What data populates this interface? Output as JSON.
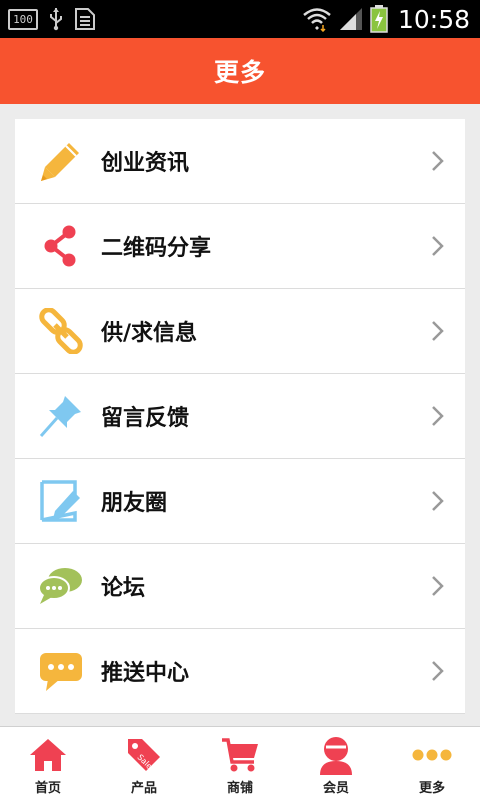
{
  "status_bar": {
    "time": "10:58",
    "battery_text": "100",
    "icons": [
      "battery-100-icon",
      "usb-icon",
      "sim-card-icon",
      "wifi-icon",
      "signal-icon",
      "charging-battery-icon"
    ]
  },
  "header": {
    "title": "更多"
  },
  "menu": {
    "items": [
      {
        "label": "创业资讯",
        "icon": "pencil-icon",
        "color": "#f5b63d"
      },
      {
        "label": "二维码分享",
        "icon": "share-icon",
        "color": "#ef4152"
      },
      {
        "label": "供/求信息",
        "icon": "chain-link-icon",
        "color": "#f5b63d"
      },
      {
        "label": "留言反馈",
        "icon": "pushpin-icon",
        "color": "#7fc8f0"
      },
      {
        "label": "朋友圈",
        "icon": "edit-note-icon",
        "color": "#7fc8f0"
      },
      {
        "label": "论坛",
        "icon": "chat-bubbles-icon",
        "color": "#a3c15a"
      },
      {
        "label": "推送中心",
        "icon": "message-bubble-icon",
        "color": "#f5b63d"
      }
    ]
  },
  "bottom_nav": {
    "items": [
      {
        "label": "首页",
        "icon": "home-icon",
        "active": false
      },
      {
        "label": "产品",
        "icon": "sale-tag-icon",
        "active": false
      },
      {
        "label": "商铺",
        "icon": "shopping-cart-icon",
        "active": false
      },
      {
        "label": "会员",
        "icon": "member-icon",
        "active": false
      },
      {
        "label": "更多",
        "icon": "more-dots-icon",
        "active": true
      }
    ],
    "accent": "#ef4152",
    "active_color": "#f5b63d"
  }
}
